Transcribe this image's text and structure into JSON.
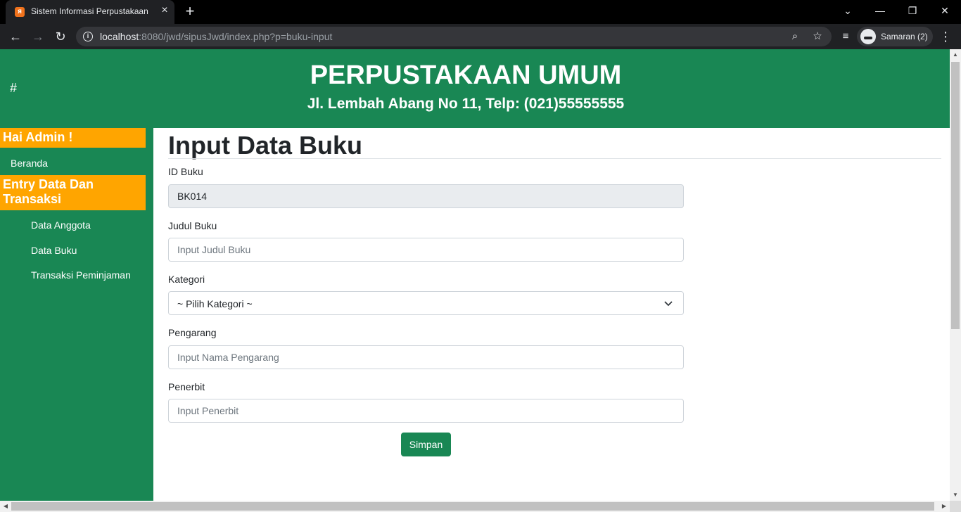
{
  "browser": {
    "tab_title": "Sistem Informasi Perpustakaan",
    "url_host": "localhost",
    "url_rest": ":8080/jwd/sipusJwd/index.php?p=buku-input",
    "profile_name": "Samaran (2)"
  },
  "header": {
    "hash": "#",
    "title": "PERPUSTAKAAN UMUM",
    "subtitle": "Jl. Lembah Abang No 11, Telp: (021)55555555",
    "bg_color": "#198754"
  },
  "sidebar": {
    "greeting": "Hai Admin !",
    "home": "Beranda",
    "section": "Entry Data Dan Transaksi",
    "items": [
      "Data Anggota",
      "Data Buku",
      "Transaksi Peminjaman"
    ],
    "accent_color": "#ffa500"
  },
  "form": {
    "title": "Input Data Buku",
    "id_label": "ID Buku",
    "id_value": "BK014",
    "judul_label": "Judul Buku",
    "judul_placeholder": "Input Judul Buku",
    "kategori_label": "Kategori",
    "kategori_selected": "~ Pilih Kategori ~",
    "pengarang_label": "Pengarang",
    "pengarang_placeholder": "Input Nama Pengarang",
    "penerbit_label": "Penerbit",
    "penerbit_placeholder": "Input Penerbit",
    "submit_label": "Simpan"
  }
}
